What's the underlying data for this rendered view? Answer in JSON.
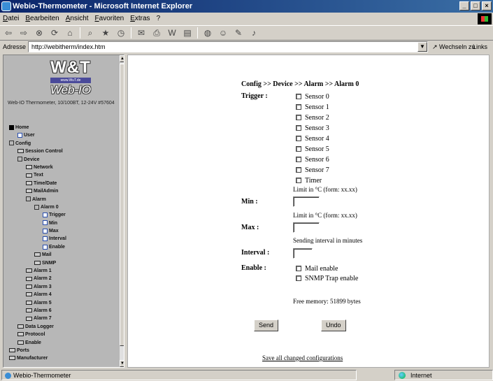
{
  "window": {
    "title": "Webio-Thermometer - Microsoft Internet Explorer"
  },
  "menu": [
    "Datei",
    "Bearbeiten",
    "Ansicht",
    "Favoriten",
    "Extras",
    "?"
  ],
  "address": {
    "label": "Adresse",
    "url": "http://webitherm/index.htm",
    "go": "Wechseln zu",
    "links": "Links"
  },
  "brand": {
    "name": "W&T",
    "url": "www.WuT.de",
    "product": "Web-IO"
  },
  "device": {
    "description": "Web-IO Thermometer, 10/100BT, 12-24V #57604"
  },
  "tree": [
    {
      "label": "Home",
      "level": 0,
      "icon": "home"
    },
    {
      "label": "User",
      "level": 1,
      "icon": "page"
    },
    {
      "label": "Config",
      "level": 0,
      "icon": "plus"
    },
    {
      "label": "Session Control",
      "level": 1,
      "icon": "folder"
    },
    {
      "label": "Device",
      "level": 1,
      "icon": "plus"
    },
    {
      "label": "Network",
      "level": 2,
      "icon": "folder"
    },
    {
      "label": "Text",
      "level": 2,
      "icon": "folder"
    },
    {
      "label": "Time/Date",
      "level": 2,
      "icon": "folder"
    },
    {
      "label": "MailAdmin",
      "level": 2,
      "icon": "folder"
    },
    {
      "label": "Alarm",
      "level": 2,
      "icon": "plus"
    },
    {
      "label": "Alarm 0",
      "level": 3,
      "icon": "plus"
    },
    {
      "label": "Trigger",
      "level": 4,
      "icon": "page"
    },
    {
      "label": "Min",
      "level": 4,
      "icon": "page"
    },
    {
      "label": "Max",
      "level": 4,
      "icon": "page"
    },
    {
      "label": "Interval",
      "level": 4,
      "icon": "page"
    },
    {
      "label": "Enable",
      "level": 4,
      "icon": "page"
    },
    {
      "label": "Mail",
      "level": 3,
      "icon": "folder"
    },
    {
      "label": "SNMP",
      "level": 3,
      "icon": "folder"
    },
    {
      "label": "Alarm 1",
      "level": 2,
      "icon": "folder"
    },
    {
      "label": "Alarm 2",
      "level": 2,
      "icon": "folder"
    },
    {
      "label": "Alarm 3",
      "level": 2,
      "icon": "folder"
    },
    {
      "label": "Alarm 4",
      "level": 2,
      "icon": "folder"
    },
    {
      "label": "Alarm 5",
      "level": 2,
      "icon": "folder"
    },
    {
      "label": "Alarm 6",
      "level": 2,
      "icon": "folder"
    },
    {
      "label": "Alarm 7",
      "level": 2,
      "icon": "folder"
    },
    {
      "label": "Data Logger",
      "level": 1,
      "icon": "folder"
    },
    {
      "label": "Protocol",
      "level": 1,
      "icon": "folder"
    },
    {
      "label": "Enable",
      "level": 1,
      "icon": "folder"
    },
    {
      "label": "Ports",
      "level": 0,
      "icon": "folder"
    },
    {
      "label": "Manufacturer",
      "level": 0,
      "icon": "folder"
    }
  ],
  "content": {
    "breadcrumb": "Config >> Device >> Alarm >> Alarm 0",
    "trigger_label": "Trigger :",
    "sensors": [
      "Sensor 0",
      "Sensor 1",
      "Sensor 2",
      "Sensor 3",
      "Sensor 4",
      "Sensor 5",
      "Sensor 6",
      "Sensor 7",
      "Timer"
    ],
    "limit_hint": "Limit in °C (form: xx.xx)",
    "min_label": "Min :",
    "max_label": "Max :",
    "interval_hint": "Sending interval in minutes",
    "interval_label": "Interval :",
    "enable_label": "Enable :",
    "enable_options": [
      "Mail enable",
      "SNMP Trap enable"
    ],
    "free_memory": "Free memory: 51899 bytes",
    "send": "Send",
    "undo": "Undo",
    "save_link": "Save all changed configurations"
  },
  "status": {
    "text": "Webio-Thermometer",
    "zone": "Internet"
  }
}
